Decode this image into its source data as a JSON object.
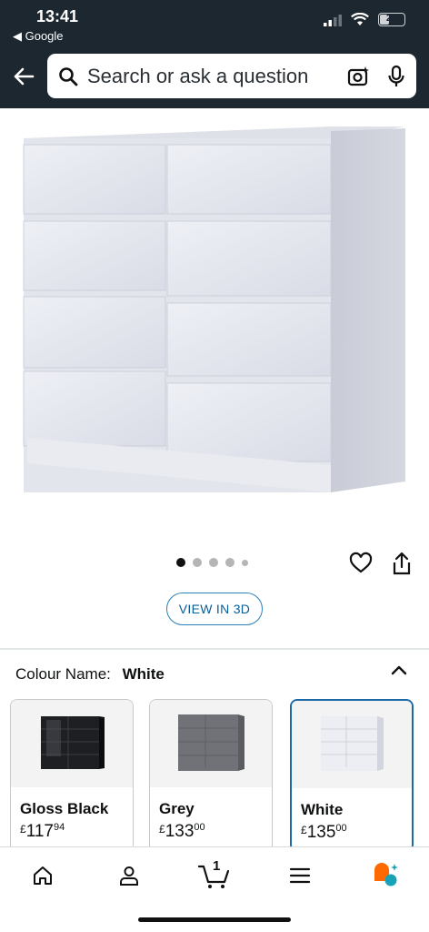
{
  "status_bar": {
    "time": "13:41",
    "back_app": "◀ Google",
    "battery": "27"
  },
  "header": {
    "search_placeholder": "Search or ask a question"
  },
  "product": {
    "image_dots": 5,
    "active_dot": 0
  },
  "actions": {
    "view_3d": "VIEW IN 3D"
  },
  "colour": {
    "label": "Colour Name:",
    "value": "White",
    "options": [
      {
        "name": "Gloss Black",
        "currency": "£",
        "whole": "117",
        "fraction": "94",
        "selected": false
      },
      {
        "name": "Grey",
        "currency": "£",
        "whole": "133",
        "fraction": "00",
        "selected": false
      },
      {
        "name": "White",
        "currency": "£",
        "whole": "135",
        "fraction": "00",
        "selected": true
      }
    ]
  },
  "bottom_nav": {
    "cart_count": "1",
    "items": [
      "home-icon",
      "account-icon",
      "cart-icon",
      "menu-icon",
      "rufus-icon"
    ]
  },
  "colors": {
    "header_bg": "#1c2730",
    "accent_blue": "#1b6aa5",
    "rufus_orange": "#ff6a00",
    "rufus_teal": "#17a2b8"
  }
}
